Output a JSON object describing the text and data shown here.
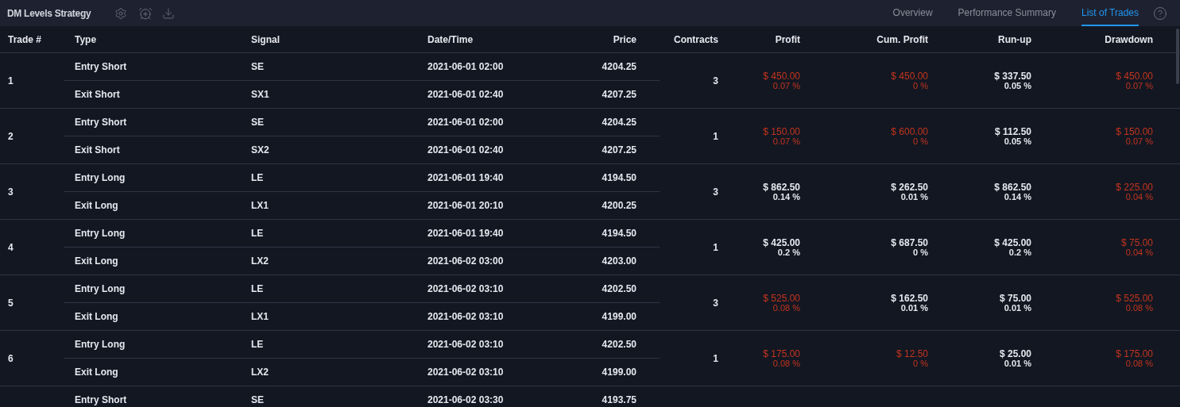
{
  "header": {
    "title": "DM Levels Strategy",
    "tabs": [
      {
        "label": "Overview",
        "selected": false
      },
      {
        "label": "Performance Summary",
        "selected": false
      },
      {
        "label": "List of Trades",
        "selected": true
      }
    ]
  },
  "table": {
    "columns": [
      "Trade #",
      "Type",
      "Signal",
      "Date/Time",
      "Price",
      "Contracts",
      "Profit",
      "Cum. Profit",
      "Run-up",
      "Drawdown"
    ],
    "rows": [
      {
        "number": "1",
        "contracts": "3",
        "profit": {
          "amount": "$ 450.00",
          "percent": "0.07 %",
          "negative": true
        },
        "cum_profit": {
          "amount": "$ 450.00",
          "percent": "0 %",
          "negative": true
        },
        "run_up": {
          "amount": "$ 337.50",
          "percent": "0.05 %",
          "negative": false
        },
        "drawdown": {
          "amount": "$ 450.00",
          "percent": "0.07 %",
          "negative": true
        },
        "legs": [
          {
            "type": "Entry Short",
            "signal": "SE",
            "datetime": "2021-06-01 02:00",
            "price": "4204.25"
          },
          {
            "type": "Exit Short",
            "signal": "SX1",
            "datetime": "2021-06-01 02:40",
            "price": "4207.25"
          }
        ]
      },
      {
        "number": "2",
        "contracts": "1",
        "profit": {
          "amount": "$ 150.00",
          "percent": "0.07 %",
          "negative": true
        },
        "cum_profit": {
          "amount": "$ 600.00",
          "percent": "0 %",
          "negative": true
        },
        "run_up": {
          "amount": "$ 112.50",
          "percent": "0.05 %",
          "negative": false
        },
        "drawdown": {
          "amount": "$ 150.00",
          "percent": "0.07 %",
          "negative": true
        },
        "legs": [
          {
            "type": "Entry Short",
            "signal": "SE",
            "datetime": "2021-06-01 02:00",
            "price": "4204.25"
          },
          {
            "type": "Exit Short",
            "signal": "SX2",
            "datetime": "2021-06-01 02:40",
            "price": "4207.25"
          }
        ]
      },
      {
        "number": "3",
        "contracts": "3",
        "profit": {
          "amount": "$ 862.50",
          "percent": "0.14 %",
          "negative": false
        },
        "cum_profit": {
          "amount": "$ 262.50",
          "percent": "0.01 %",
          "negative": false
        },
        "run_up": {
          "amount": "$ 862.50",
          "percent": "0.14 %",
          "negative": false
        },
        "drawdown": {
          "amount": "$ 225.00",
          "percent": "0.04 %",
          "negative": true
        },
        "legs": [
          {
            "type": "Entry Long",
            "signal": "LE",
            "datetime": "2021-06-01 19:40",
            "price": "4194.50"
          },
          {
            "type": "Exit Long",
            "signal": "LX1",
            "datetime": "2021-06-01 20:10",
            "price": "4200.25"
          }
        ]
      },
      {
        "number": "4",
        "contracts": "1",
        "profit": {
          "amount": "$ 425.00",
          "percent": "0.2 %",
          "negative": false
        },
        "cum_profit": {
          "amount": "$ 687.50",
          "percent": "0 %",
          "negative": false
        },
        "run_up": {
          "amount": "$ 425.00",
          "percent": "0.2 %",
          "negative": false
        },
        "drawdown": {
          "amount": "$ 75.00",
          "percent": "0.04 %",
          "negative": true
        },
        "legs": [
          {
            "type": "Entry Long",
            "signal": "LE",
            "datetime": "2021-06-01 19:40",
            "price": "4194.50"
          },
          {
            "type": "Exit Long",
            "signal": "LX2",
            "datetime": "2021-06-02 03:00",
            "price": "4203.00"
          }
        ]
      },
      {
        "number": "5",
        "contracts": "3",
        "profit": {
          "amount": "$ 525.00",
          "percent": "0.08 %",
          "negative": true
        },
        "cum_profit": {
          "amount": "$ 162.50",
          "percent": "0.01 %",
          "negative": false
        },
        "run_up": {
          "amount": "$ 75.00",
          "percent": "0.01 %",
          "negative": false
        },
        "drawdown": {
          "amount": "$ 525.00",
          "percent": "0.08 %",
          "negative": true
        },
        "legs": [
          {
            "type": "Entry Long",
            "signal": "LE",
            "datetime": "2021-06-02 03:10",
            "price": "4202.50"
          },
          {
            "type": "Exit Long",
            "signal": "LX1",
            "datetime": "2021-06-02 03:10",
            "price": "4199.00"
          }
        ]
      },
      {
        "number": "6",
        "contracts": "1",
        "profit": {
          "amount": "$ 175.00",
          "percent": "0.08 %",
          "negative": true
        },
        "cum_profit": {
          "amount": "$ 12.50",
          "percent": "0 %",
          "negative": true
        },
        "run_up": {
          "amount": "$ 25.00",
          "percent": "0.01 %",
          "negative": false
        },
        "drawdown": {
          "amount": "$ 175.00",
          "percent": "0.08 %",
          "negative": true
        },
        "legs": [
          {
            "type": "Entry Long",
            "signal": "LE",
            "datetime": "2021-06-02 03:10",
            "price": "4202.50"
          },
          {
            "type": "Exit Long",
            "signal": "LX2",
            "datetime": "2021-06-02 03:10",
            "price": "4199.00"
          }
        ]
      },
      {
        "legs": [
          {
            "type": "Entry Short",
            "signal": "SE",
            "datetime": "2021-06-02 03:30",
            "price": "4193.75"
          }
        ]
      }
    ]
  }
}
